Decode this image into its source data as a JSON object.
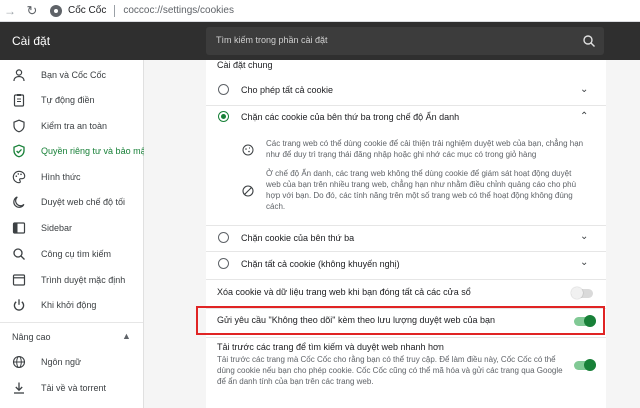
{
  "address_bar": {
    "site_name": "Cốc Cốc",
    "url": "coccoc://settings/cookies"
  },
  "header": {
    "title": "Cài đặt",
    "search_placeholder": "Tìm kiếm trong phần cài đặt"
  },
  "sidebar": {
    "items": [
      {
        "label": "Bạn và Cốc Cốc",
        "icon": "person-icon"
      },
      {
        "label": "Tự động điền",
        "icon": "clipboard-icon"
      },
      {
        "label": "Kiểm tra an toàn",
        "icon": "shield-icon"
      },
      {
        "label": "Quyền riêng tư và bảo mật",
        "icon": "shield-check-icon"
      },
      {
        "label": "Hình thức",
        "icon": "palette-icon"
      },
      {
        "label": "Duyệt web chế độ tối",
        "icon": "moon-icon"
      },
      {
        "label": "Sidebar",
        "icon": "sidebar-icon"
      },
      {
        "label": "Công cụ tìm kiếm",
        "icon": "search-icon"
      },
      {
        "label": "Trình duyệt mặc định",
        "icon": "browser-icon"
      },
      {
        "label": "Khi khởi động",
        "icon": "power-icon"
      }
    ],
    "advanced_label": "Nâng cao",
    "advanced_items": [
      {
        "label": "Ngôn ngữ",
        "icon": "globe-icon"
      },
      {
        "label": "Tải về và torrent",
        "icon": "download-icon"
      }
    ]
  },
  "content": {
    "section_title": "Cài đặt chung",
    "options": [
      {
        "label": "Cho phép tất cả cookie"
      },
      {
        "label": "Chặn các cookie của bên thứ ba trong chế độ Ẩn danh"
      },
      {
        "label": "Chặn cookie của bên thứ ba"
      },
      {
        "label": "Chặn tất cả cookie (không khuyến nghị)"
      }
    ],
    "desc1": "Các trang web có thể dùng cookie để cải thiện trải nghiệm duyệt web của bạn, chẳng hạn như để duy trì trạng thái đăng nhập hoặc ghi nhớ các mục có trong giỏ hàng",
    "desc2": "Ở chế độ Ẩn danh, các trang web không thể dùng cookie để giám sát hoạt động duyệt web của bạn trên nhiều trang web, chẳng hạn như nhằm điều chỉnh quảng cáo cho phù hợp với bạn. Do đó, các tính năng trên một số trang web có thể hoạt động không đúng cách.",
    "clear_on_exit": "Xóa cookie và dữ liệu trang web khi bạn đóng tất cả các cửa sổ",
    "dnt": "Gửi yêu cầu \"Không theo dõi\" kèm theo lưu lượng duyệt web của bạn",
    "preload_title": "Tải trước các trang để tìm kiếm và duyệt web nhanh hơn",
    "preload_desc": "Tải trước các trang mà Cốc Cốc cho rằng bạn có thể truy cập. Để làm điều này, Cốc Cốc có thể dùng cookie nếu bạn cho phép cookie. Cốc Cốc cũng có thể mã hóa và gửi các trang qua Google để ẩn danh tính của bạn trên các trang web."
  },
  "states": {
    "selected_option": 1,
    "clear_on_exit": "off",
    "dnt": "on",
    "preload": "on"
  },
  "colors": {
    "header_bg": "#2f2f2f",
    "accent_green": "#188038",
    "highlight_red": "#e02424"
  }
}
